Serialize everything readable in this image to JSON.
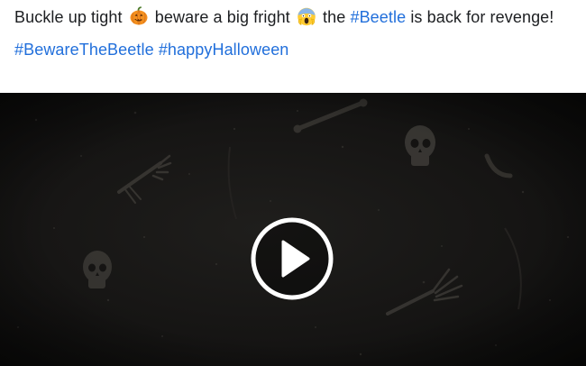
{
  "post": {
    "caption": {
      "text_1": "Buckle up tight",
      "emoji_1": "jack-o-lantern",
      "text_2": "beware a big fright",
      "emoji_2": "face-screaming-in-fear",
      "text_3": "the",
      "hashtag_1": "#Beetle",
      "text_4": "is back for revenge!"
    },
    "hashtags": [
      "#BewareTheBeetle",
      "#happyHalloween"
    ],
    "link_color": "#216fdb"
  },
  "video": {
    "play_icon": "play-icon",
    "background_color": "#161514"
  }
}
